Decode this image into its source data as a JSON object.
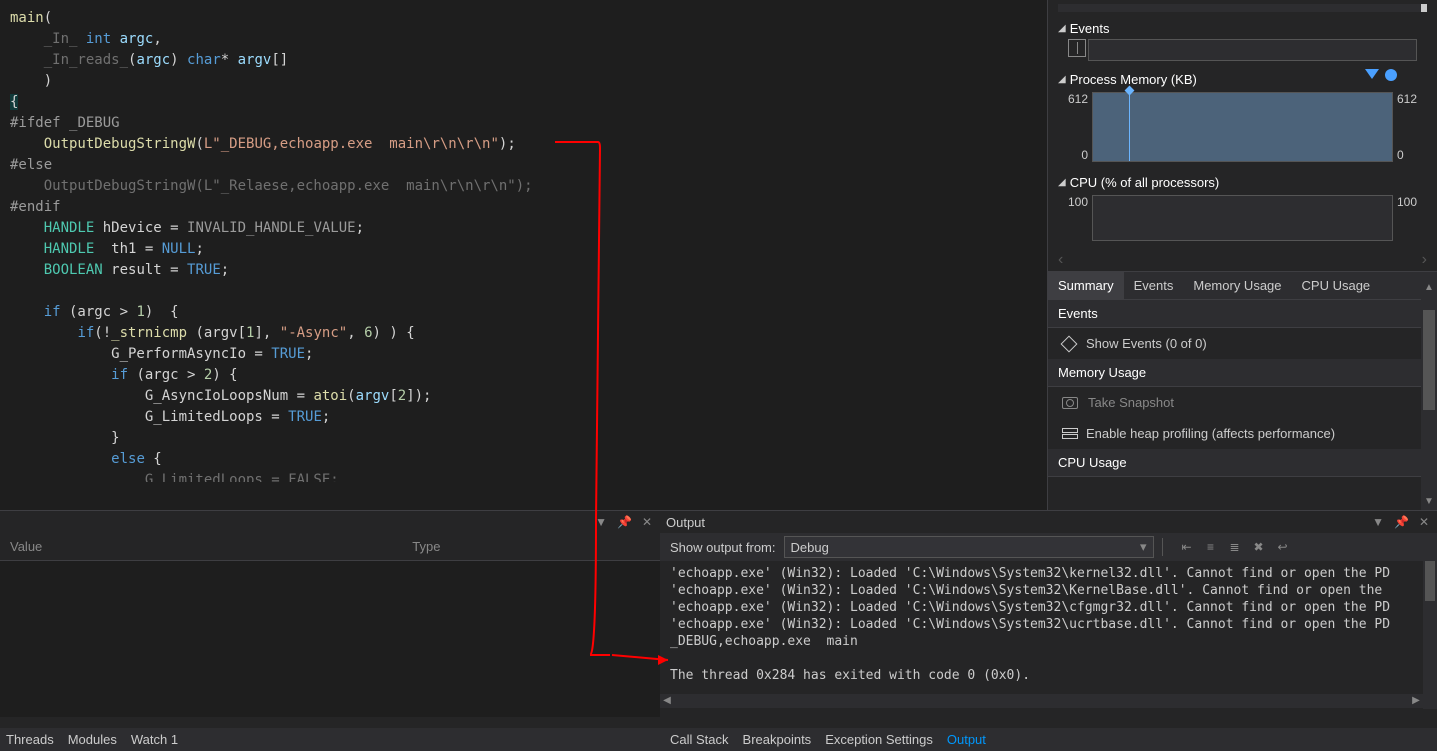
{
  "code": {
    "lines": [
      {
        "segs": [
          {
            "t": "main",
            "c": "fn"
          },
          {
            "t": "(",
            "c": ""
          }
        ]
      },
      {
        "segs": [
          {
            "t": "    ",
            "c": ""
          },
          {
            "t": "_In_",
            "c": "sal"
          },
          {
            "t": " ",
            "c": ""
          },
          {
            "t": "int",
            "c": "kw"
          },
          {
            "t": " ",
            "c": ""
          },
          {
            "t": "argc",
            "c": "param"
          },
          {
            "t": ",",
            "c": ""
          }
        ]
      },
      {
        "segs": [
          {
            "t": "    ",
            "c": ""
          },
          {
            "t": "_In_reads_",
            "c": "sal"
          },
          {
            "t": "(",
            "c": ""
          },
          {
            "t": "argc",
            "c": "param"
          },
          {
            "t": ") ",
            "c": ""
          },
          {
            "t": "char",
            "c": "kw"
          },
          {
            "t": "* ",
            "c": ""
          },
          {
            "t": "argv",
            "c": "param"
          },
          {
            "t": "[]",
            "c": ""
          }
        ]
      },
      {
        "segs": [
          {
            "t": "    )",
            "c": ""
          }
        ]
      },
      {
        "segs": [
          {
            "t": "{",
            "c": "highlight-br"
          }
        ]
      },
      {
        "segs": [
          {
            "t": "#ifdef ",
            "c": "preproc"
          },
          {
            "t": "_DEBUG",
            "c": "mac"
          }
        ]
      },
      {
        "segs": [
          {
            "t": "    ",
            "c": ""
          },
          {
            "t": "OutputDebugStringW",
            "c": "fn"
          },
          {
            "t": "(",
            "c": ""
          },
          {
            "t": "L\"_DEBUG,echoapp.exe  main\\r\\n\\r\\n\"",
            "c": "str"
          },
          {
            "t": ");",
            "c": ""
          }
        ]
      },
      {
        "segs": [
          {
            "t": "#else",
            "c": "preproc"
          }
        ]
      },
      {
        "segs": [
          {
            "t": "    OutputDebugStringW(L\"_Relaese,echoapp.exe  main\\r\\n\\r\\n\");",
            "c": "dim"
          }
        ]
      },
      {
        "segs": [
          {
            "t": "#endif",
            "c": "preproc"
          }
        ]
      },
      {
        "segs": [
          {
            "t": "    ",
            "c": ""
          },
          {
            "t": "HANDLE",
            "c": "type"
          },
          {
            "t": " hDevice = ",
            "c": ""
          },
          {
            "t": "INVALID_HANDLE_VALUE",
            "c": "mac"
          },
          {
            "t": ";",
            "c": ""
          }
        ]
      },
      {
        "segs": [
          {
            "t": "    ",
            "c": ""
          },
          {
            "t": "HANDLE",
            "c": "type"
          },
          {
            "t": "  th1 = ",
            "c": ""
          },
          {
            "t": "NULL",
            "c": "kw"
          },
          {
            "t": ";",
            "c": ""
          }
        ]
      },
      {
        "segs": [
          {
            "t": "    ",
            "c": ""
          },
          {
            "t": "BOOLEAN",
            "c": "type"
          },
          {
            "t": " result = ",
            "c": ""
          },
          {
            "t": "TRUE",
            "c": "kw"
          },
          {
            "t": ";",
            "c": ""
          }
        ]
      },
      {
        "segs": [
          {
            "t": " ",
            "c": ""
          }
        ]
      },
      {
        "segs": [
          {
            "t": "    ",
            "c": ""
          },
          {
            "t": "if",
            "c": "kw"
          },
          {
            "t": " (argc > ",
            "c": ""
          },
          {
            "t": "1",
            "c": "num"
          },
          {
            "t": ")  {",
            "c": ""
          }
        ]
      },
      {
        "segs": [
          {
            "t": "        ",
            "c": ""
          },
          {
            "t": "if",
            "c": "kw"
          },
          {
            "t": "(!",
            "c": ""
          },
          {
            "t": "_strnicmp",
            "c": "fn"
          },
          {
            "t": " (argv[",
            "c": ""
          },
          {
            "t": "1",
            "c": "num"
          },
          {
            "t": "], ",
            "c": ""
          },
          {
            "t": "\"-Async\"",
            "c": "str"
          },
          {
            "t": ", ",
            "c": ""
          },
          {
            "t": "6",
            "c": "num"
          },
          {
            "t": ") ) {",
            "c": ""
          }
        ]
      },
      {
        "segs": [
          {
            "t": "            G_PerformAsyncIo = ",
            "c": ""
          },
          {
            "t": "TRUE",
            "c": "kw"
          },
          {
            "t": ";",
            "c": ""
          }
        ]
      },
      {
        "segs": [
          {
            "t": "            ",
            "c": ""
          },
          {
            "t": "if",
            "c": "kw"
          },
          {
            "t": " (argc > ",
            "c": ""
          },
          {
            "t": "2",
            "c": "num"
          },
          {
            "t": ") {",
            "c": ""
          }
        ]
      },
      {
        "segs": [
          {
            "t": "                G_AsyncIoLoopsNum = ",
            "c": ""
          },
          {
            "t": "atoi",
            "c": "fn"
          },
          {
            "t": "(",
            "c": ""
          },
          {
            "t": "argv",
            "c": "param"
          },
          {
            "t": "[",
            "c": ""
          },
          {
            "t": "2",
            "c": "num"
          },
          {
            "t": "]);",
            "c": ""
          }
        ]
      },
      {
        "segs": [
          {
            "t": "                G_LimitedLoops = ",
            "c": ""
          },
          {
            "t": "TRUE",
            "c": "kw"
          },
          {
            "t": ";",
            "c": ""
          }
        ]
      },
      {
        "segs": [
          {
            "t": "            }",
            "c": ""
          }
        ]
      },
      {
        "segs": [
          {
            "t": "            ",
            "c": ""
          },
          {
            "t": "else",
            "c": "kw"
          },
          {
            "t": " {",
            "c": ""
          }
        ]
      },
      {
        "segs": [
          {
            "t": "                G_LimitedLoops = FALSE;",
            "c": "dim"
          }
        ]
      }
    ]
  },
  "diag": {
    "events_title": "Events",
    "mem_title": "Process Memory (KB)",
    "mem_top": "612",
    "mem_bot": "0",
    "mem_top_r": "612",
    "mem_bot_r": "0",
    "cpu_title": "CPU (% of all processors)",
    "cpu_top": "100",
    "cpu_top_r": "100",
    "tabs": [
      "Summary",
      "Events",
      "Memory Usage",
      "CPU Usage"
    ],
    "summary": {
      "events_head": "Events",
      "events_item": "Show Events (0 of 0)",
      "mem_head": "Memory Usage",
      "mem_item1": "Take Snapshot",
      "mem_item2": "Enable heap profiling (affects performance)",
      "cpu_head": "CPU Usage"
    }
  },
  "watch": {
    "col_value": "Value",
    "col_type": "Type"
  },
  "output": {
    "title": "Output",
    "from_label": "Show output from:",
    "from_value": "Debug",
    "lines": [
      "'echoapp.exe' (Win32): Loaded 'C:\\Windows\\System32\\kernel32.dll'. Cannot find or open the PD",
      "'echoapp.exe' (Win32): Loaded 'C:\\Windows\\System32\\KernelBase.dll'. Cannot find or open the",
      "'echoapp.exe' (Win32): Loaded 'C:\\Windows\\System32\\cfgmgr32.dll'. Cannot find or open the PD",
      "'echoapp.exe' (Win32): Loaded 'C:\\Windows\\System32\\ucrtbase.dll'. Cannot find or open the PD",
      "_DEBUG,echoapp.exe  main",
      "",
      "The thread 0x284 has exited with code 0 (0x0)."
    ]
  },
  "tabs_left": [
    "Threads",
    "Modules",
    "Watch 1"
  ],
  "tabs_right": [
    "Call Stack",
    "Breakpoints",
    "Exception Settings",
    "Output"
  ],
  "chart_data": [
    {
      "type": "area",
      "title": "Process Memory (KB)",
      "ylim": [
        0,
        612
      ],
      "series": [
        {
          "name": "Memory",
          "values": [
            612
          ]
        }
      ]
    },
    {
      "type": "line",
      "title": "CPU (% of all processors)",
      "ylim": [
        0,
        100
      ],
      "series": [
        {
          "name": "CPU",
          "values": []
        }
      ]
    }
  ]
}
